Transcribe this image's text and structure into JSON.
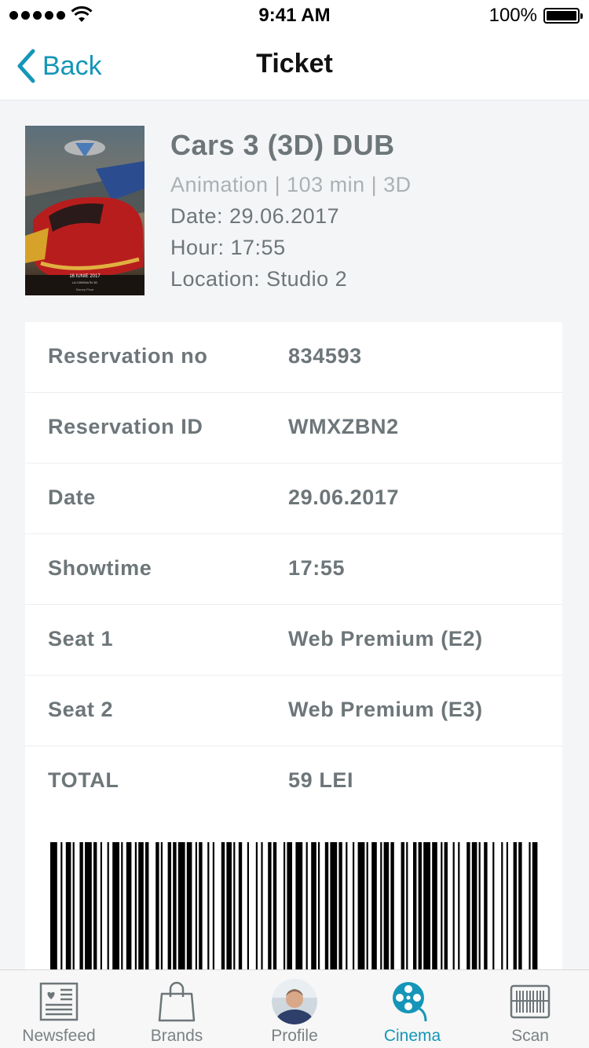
{
  "status_bar": {
    "time": "9:41 AM",
    "battery": "100%"
  },
  "nav": {
    "back_label": "Back",
    "title": "Ticket"
  },
  "movie": {
    "title": "Cars 3 (3D) DUB",
    "meta": "Animation | 103 min | 3D",
    "date": "Date: 29.06.2017",
    "hour": "Hour: 17:55",
    "location": "Location: Studio 2",
    "poster": {
      "logo_text": "Disney·Pixar",
      "caption": "16 IUNIE 2017",
      "subcaption": "LA CINEMA ÎN 3D"
    }
  },
  "details": [
    {
      "label": "Reservation no",
      "value": "834593"
    },
    {
      "label": "Reservation ID",
      "value": "WMXZBN2"
    },
    {
      "label": "Date",
      "value": "29.06.2017"
    },
    {
      "label": "Showtime",
      "value": "17:55"
    },
    {
      "label": "Seat 1",
      "value": "Web Premium (E2)"
    },
    {
      "label": "Seat 2",
      "value": "Web Premium (E3)"
    },
    {
      "label": "TOTAL",
      "value": "59 LEI"
    }
  ],
  "tabs": [
    {
      "label": "Newsfeed",
      "icon": "newspaper-icon"
    },
    {
      "label": "Brands",
      "icon": "shopping-bag-icon"
    },
    {
      "label": "Profile",
      "icon": "avatar"
    },
    {
      "label": "Cinema",
      "icon": "film-reel-icon",
      "active": true
    },
    {
      "label": "Scan",
      "icon": "barcode-scan-icon"
    }
  ],
  "colors": {
    "accent": "#1596b8",
    "text": "#6d7679",
    "muted": "#aab1b4",
    "background": "#f4f5f7"
  }
}
